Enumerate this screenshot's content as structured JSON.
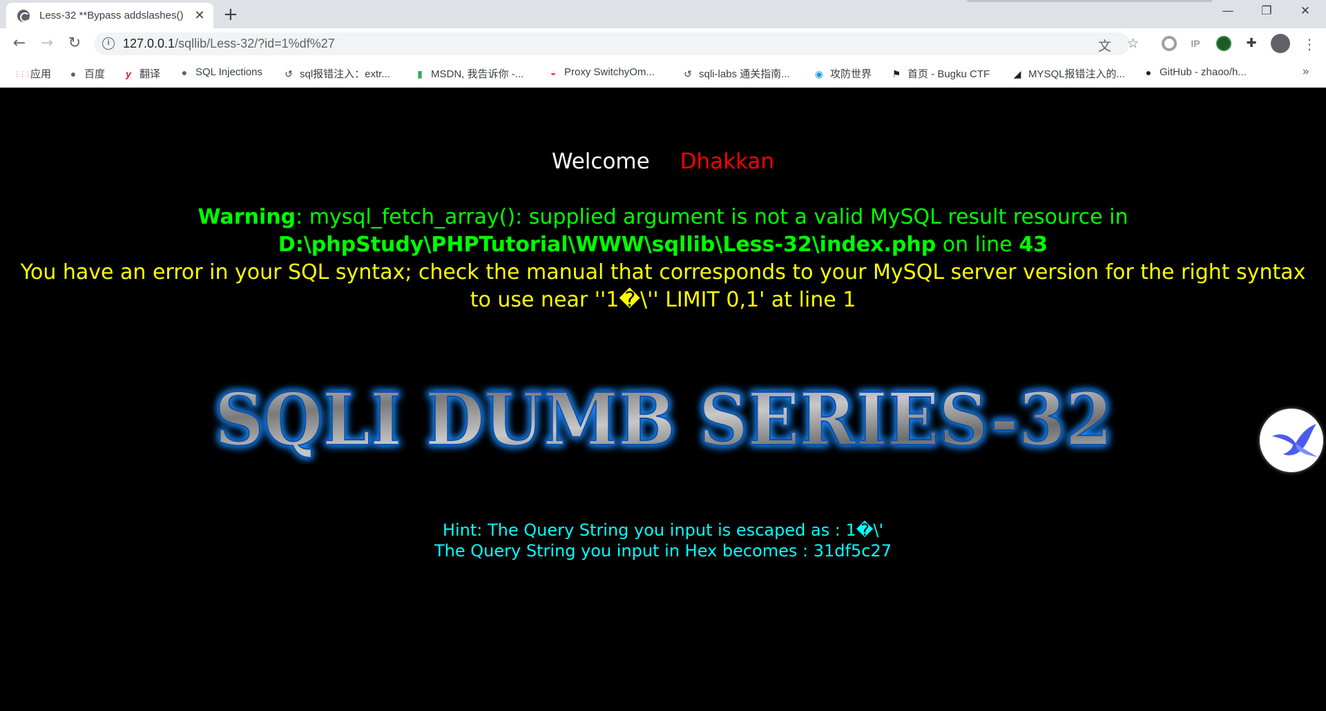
{
  "browser": {
    "tab_title": "Less-32 **Bypass addslashes()",
    "tab_close": "✕",
    "new_tab": "+",
    "url_host": "127.0.0.1",
    "url_path": "/sqllib/Less-32/?id=1%df%27",
    "ext_ip": "IP",
    "bookmarks_more": "»",
    "bookmarks": [
      {
        "label": "应用",
        "icon": "apps-grid-icon"
      },
      {
        "label": "百度",
        "icon": "globe-icon"
      },
      {
        "label": "翻译",
        "icon": "youdao-icon"
      },
      {
        "label": "SQL Injections",
        "icon": "globe-icon"
      },
      {
        "label": "sql报错注入：extr...",
        "icon": "leaf-icon"
      },
      {
        "label": "MSDN, 我告诉你 -...",
        "icon": "msdn-icon"
      },
      {
        "label": "Proxy SwitchyOm...",
        "icon": "switchy-icon"
      },
      {
        "label": "sqli-labs 通关指南...",
        "icon": "leaf-icon"
      },
      {
        "label": "攻防世界",
        "icon": "swirl-icon"
      },
      {
        "label": "首页 - Bugku CTF",
        "icon": "flag-icon"
      },
      {
        "label": "MYSQL报错注入的...",
        "icon": "slash-icon"
      },
      {
        "label": "GitHub - zhaoo/h...",
        "icon": "github-icon"
      }
    ]
  },
  "page": {
    "welcome": "Welcome",
    "user": "Dhakkan",
    "warning_label": "Warning",
    "warning_text": ": mysql_fetch_array(): supplied argument is not a valid MySQL result resource in",
    "warning_path": "D:\\phpStudy\\PHPTutorial\\WWW\\sqllib\\Less-32\\index.php",
    "warning_online": " on line ",
    "warning_line": "43",
    "sql_error": "You have an error in your SQL syntax; check the manual that corresponds to your MySQL server version for the right syntax to use near ''1�\\'' LIMIT 0,1' at line 1",
    "banner": "SQLI DUMB SERIES-32",
    "hint_escaped": "Hint: The Query String you input is escaped as : 1�\\'",
    "hint_hex": "The Query String you input in Hex becomes : 31df5c27"
  },
  "colors": {
    "warning_green": "#00ff00",
    "error_yellow": "#ffff00",
    "user_red": "#ff0000",
    "hint_cyan": "#00ffff"
  }
}
